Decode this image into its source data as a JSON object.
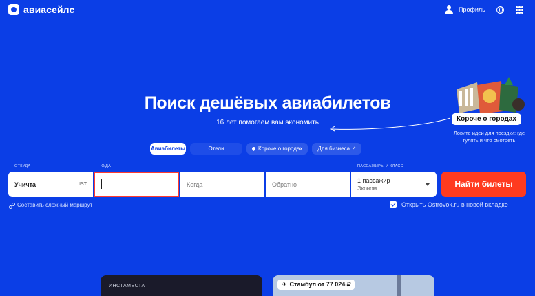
{
  "header": {
    "logo_text": "авиасейлс",
    "profile_label": "Профиль"
  },
  "hero": {
    "title": "Поиск дешёвых авиабилетов",
    "subtitle": "16 лет помогаем вам экономить"
  },
  "tabs": [
    {
      "label": "Авиабилеты",
      "active": true
    },
    {
      "label": "Отели",
      "active": false
    },
    {
      "label": "Короче о городах",
      "active": false
    },
    {
      "label": "Для бизнеса",
      "active": false
    }
  ],
  "search": {
    "from_label": "ОТКУДА",
    "from_value": "Учичта",
    "from_code": "IST",
    "to_label": "КУДА",
    "to_value": "",
    "date_placeholder": "Когда",
    "return_placeholder": "Обратно",
    "passengers_label": "ПАССАЖИРЫ И КЛАСС",
    "passengers_value": "1 пассажир",
    "class_value": "Эконом",
    "find_button": "Найти билеты"
  },
  "options": {
    "complex_route": "Составить сложный маршрут",
    "ostrovok": "Открыть Ostrovok.ru в новой вкладке"
  },
  "promo": {
    "label": "Короче о городах",
    "description": "Ловите идеи для поездки: где гулять и что смотреть"
  },
  "cards": [
    {
      "title": "ИНСТАМЕСТА"
    },
    {
      "title": "Стамбул от 77 024 ₽"
    }
  ],
  "colors": {
    "background": "#0b3ee6",
    "accent_red": "#ff3b1f"
  }
}
